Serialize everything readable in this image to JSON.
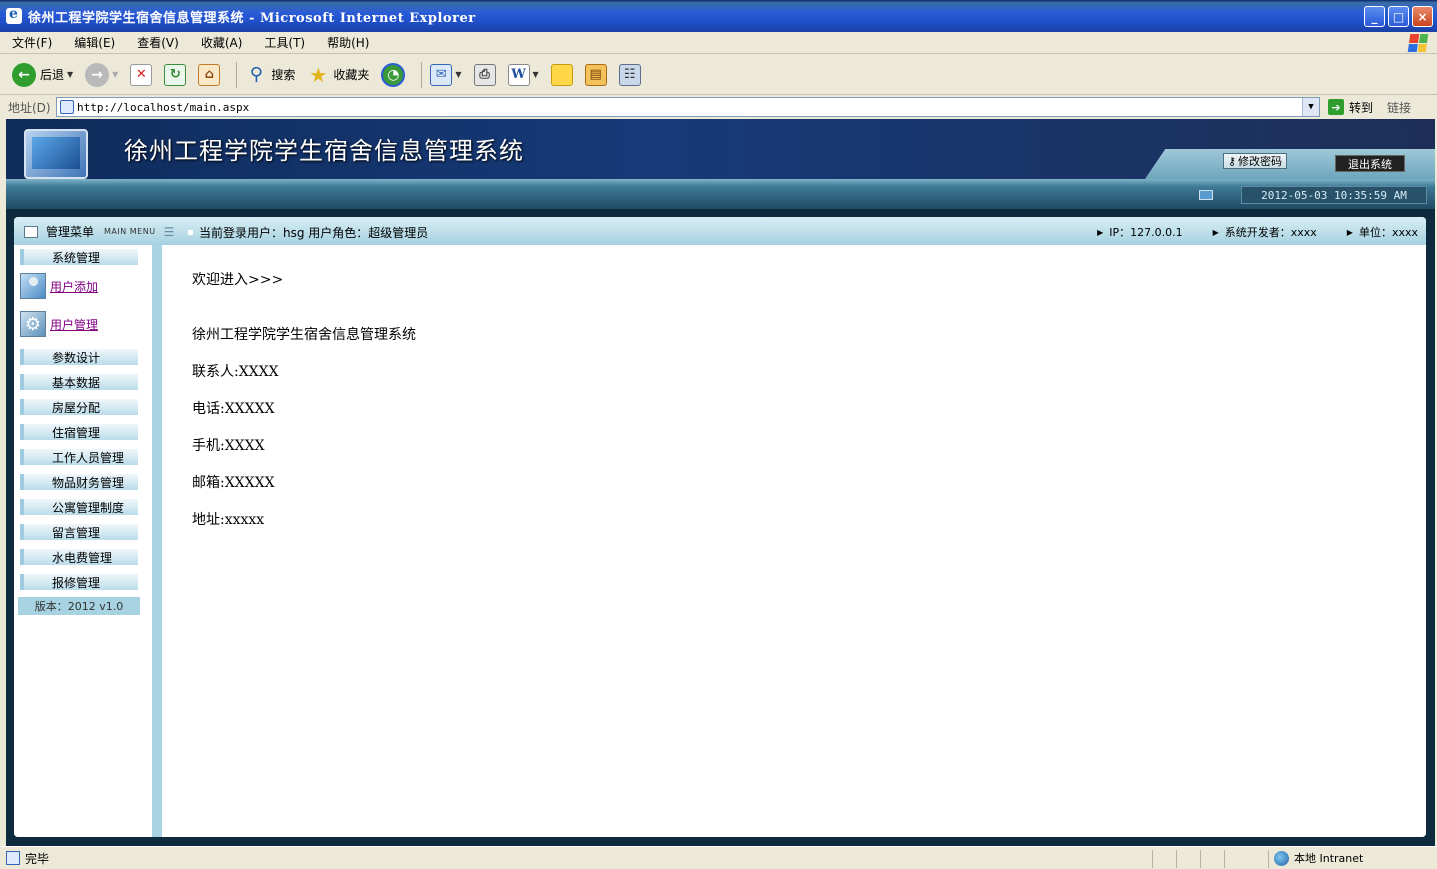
{
  "window": {
    "title": "徐州工程学院学生宿舍信息管理系统 - Microsoft Internet Explorer",
    "minimize": "_",
    "maximize": "□",
    "close": "×"
  },
  "menubar": {
    "items": [
      "文件(F)",
      "编辑(E)",
      "查看(V)",
      "收藏(A)",
      "工具(T)",
      "帮助(H)"
    ]
  },
  "toolbar": {
    "back_label": "后退",
    "search_label": "搜索",
    "favorites_label": "收藏夹"
  },
  "address": {
    "label": "地址(D)",
    "url": "http://localhost/main.aspx",
    "go_label": "转到",
    "links_label": "链接"
  },
  "banner": {
    "title": "徐州工程学院学生宿舍信息管理系统",
    "change_password": "修改密码",
    "logout": "退出系统",
    "datetime": "2012-05-03 10:35:59 AM"
  },
  "infostrip": {
    "menu_title": "管理菜单",
    "menu_subtitle": "MAIN MENU",
    "user_info": "当前登录用户：hsg  用户角色：超级管理员",
    "ip": "IP：127.0.0.1",
    "developer": "系统开发者：xxxx",
    "unit": "单位：xxxx"
  },
  "sidebar": {
    "system_management": "系统管理",
    "sub_items": [
      {
        "label": "用户添加",
        "icon": "user-icon"
      },
      {
        "label": "用户管理",
        "icon": "gear-icon"
      }
    ],
    "menu_items": [
      "参数设计",
      "基本数据",
      "房屋分配",
      "住宿管理",
      "工作人员管理",
      "物品财务管理",
      "公寓管理制度",
      "留言管理",
      "水电费管理",
      "报修管理"
    ],
    "version": "版本：2012  v1.0"
  },
  "main": {
    "welcome": "欢迎进入>>>",
    "system_name": "徐州工程学院学生宿舍信息管理系统",
    "contact": "联系人:XXXX",
    "phone": "电话:XXXXX",
    "mobile": "手机:XXXX",
    "email": "邮箱:XXXXX",
    "address": "地址:xxxxx"
  },
  "statusbar": {
    "status": "完毕",
    "zone": "本地 Intranet"
  },
  "colors": {
    "banner_dark": "#0f2b5a",
    "strip_light": "#a6d2e1",
    "link_visited": "#800080"
  }
}
